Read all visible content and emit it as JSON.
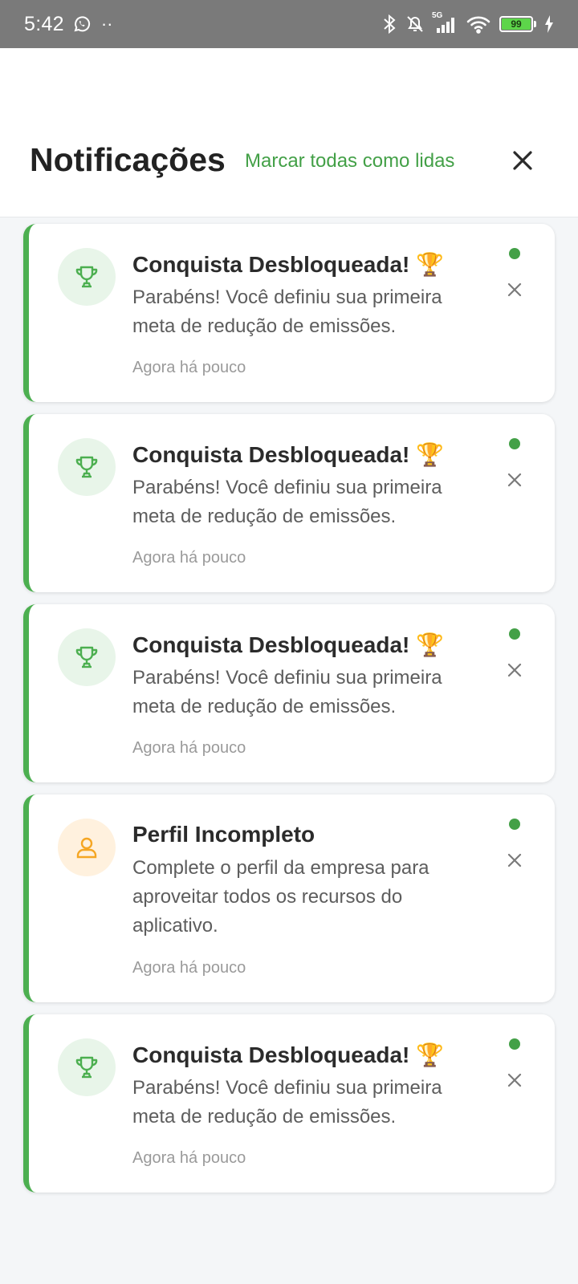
{
  "status_bar": {
    "time": "5:42",
    "network_tag": "5G",
    "battery_level": "99",
    "icons": [
      "whatsapp-icon",
      "bluetooth-icon",
      "muted-bell-icon",
      "signal-icon",
      "wifi-icon",
      "battery-icon",
      "charging-icon"
    ]
  },
  "header": {
    "title": "Notificações",
    "mark_all_label": "Marcar todas como lidas",
    "close_icon": "close-icon",
    "accent_color": "#43a047"
  },
  "notifications": [
    {
      "title": "Conquista Desbloqueada! 🏆",
      "body": "Parabéns! Você definiu sua primeira meta de redução de emissões.",
      "time": "Agora há pouco",
      "icon": "trophy-icon",
      "unread": true
    },
    {
      "title": "Conquista Desbloqueada! 🏆",
      "body": "Parabéns! Você definiu sua primeira meta de redução de emissões.",
      "time": "Agora há pouco",
      "icon": "trophy-icon",
      "unread": true
    },
    {
      "title": "Conquista Desbloqueada! 🏆",
      "body": "Parabéns! Você definiu sua primeira meta de redução de emissões.",
      "time": "Agora há pouco",
      "icon": "trophy-icon",
      "unread": true
    },
    {
      "title": "Perfil Incompleto",
      "body": "Complete o perfil da empresa para aproveitar todos os recursos do aplicativo.",
      "time": "Agora há pouco",
      "icon": "user-icon",
      "unread": true
    },
    {
      "title": "Conquista Desbloqueada! 🏆",
      "body": "Parabéns! Você definiu sua primeira meta de redução de emissões.",
      "time": "Agora há pouco",
      "icon": "trophy-icon",
      "unread": true
    }
  ]
}
